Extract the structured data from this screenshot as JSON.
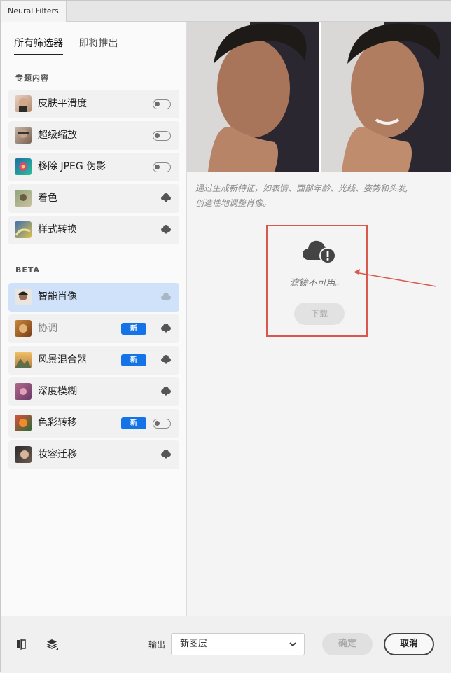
{
  "window": {
    "tab_title": "Neural Filters"
  },
  "left_nav": {
    "tabs": [
      {
        "label": "所有筛选器",
        "active": true
      },
      {
        "label": "即将推出",
        "active": false
      }
    ]
  },
  "sections": {
    "featured": "专题内容",
    "beta": "BETA"
  },
  "filters": [
    {
      "label": "皮肤平滑度",
      "control": "toggle"
    },
    {
      "label": "超级缩放",
      "control": "toggle"
    },
    {
      "label": "移除 JPEG 伪影",
      "control": "toggle"
    },
    {
      "label": "着色",
      "control": "cloud-download"
    },
    {
      "label": "样式转换",
      "control": "cloud-download"
    },
    {
      "label": "智能肖像",
      "control": "cloud",
      "selected": true
    },
    {
      "label": "协调",
      "control": "cloud-download",
      "badge": "新",
      "dimmed": true
    },
    {
      "label": "风景混合器",
      "control": "cloud-download",
      "badge": "新"
    },
    {
      "label": "深度模糊",
      "control": "cloud-download"
    },
    {
      "label": "色彩转移",
      "control": "toggle",
      "badge": "新"
    },
    {
      "label": "妆容迁移",
      "control": "cloud-download"
    }
  ],
  "detail": {
    "description_line1": "通过生成新特征，如表情、面部年龄、光线、姿势和头发,",
    "description_line2": "创造性地调整肖像。",
    "unavailable_text": "滤镜不可用。",
    "download_label": "下载"
  },
  "footer": {
    "output_label": "输出",
    "output_value": "新图层",
    "ok_label": "确定",
    "cancel_label": "取消"
  },
  "colors": {
    "accent": "#1473e6",
    "selected_bg": "#cfe2fa",
    "annotation": "#d9574b"
  }
}
